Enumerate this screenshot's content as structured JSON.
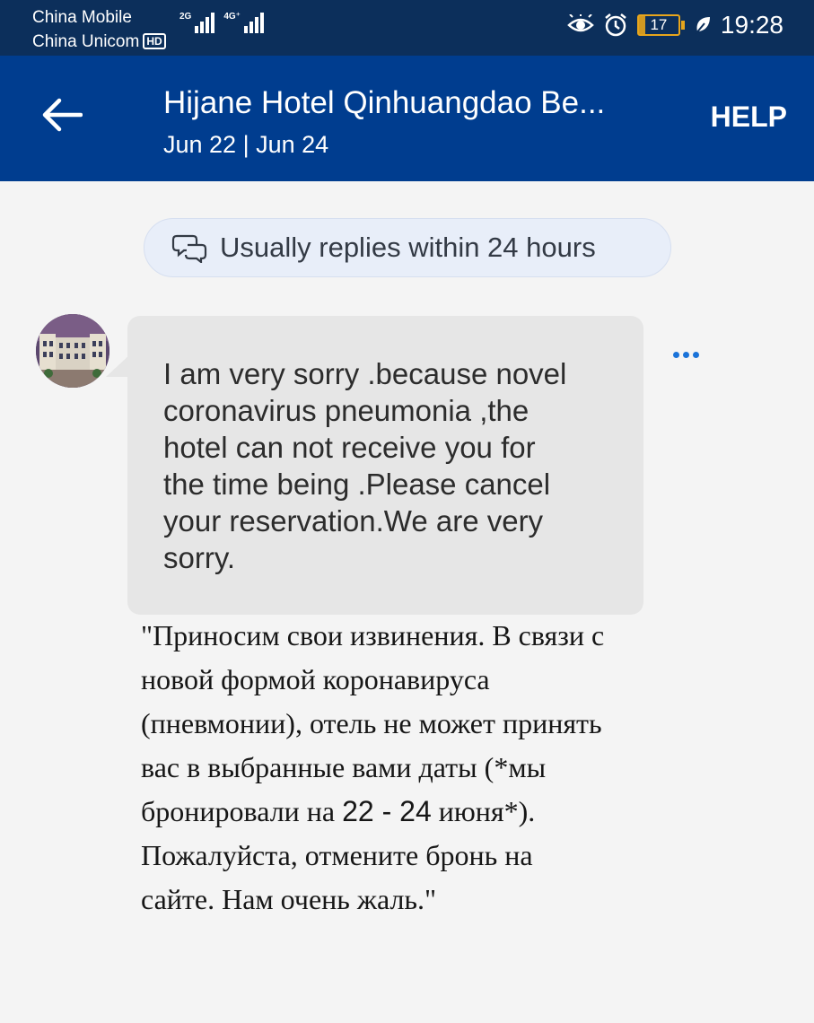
{
  "status_bar": {
    "carrier1": "China Mobile",
    "carrier2": "China Unicom",
    "hd_badge": "HD",
    "signal1_tag": "2G",
    "signal2_tag": "4G⁺",
    "battery": "17",
    "time": "19:28",
    "icons": [
      "eye-icon",
      "alarm-icon",
      "battery-icon",
      "leaf-icon"
    ]
  },
  "app_bar": {
    "title": "Hijane Hotel Qinhuangdao Be...",
    "dates": "Jun 22 | Jun 24",
    "help_label": "HELP",
    "background_color": "#003d8f"
  },
  "reply_pill": {
    "text": "Usually replies within 24 hours"
  },
  "message": {
    "lines": [
      "I am very sorry .because novel",
      "coronavirus pneumonia ,the",
      "hotel can not receive you for",
      "the time being .Please cancel",
      "your reservation.We are very",
      "sorry."
    ]
  },
  "translation": {
    "line1": "\"Приносим свои извинения. В связи с",
    "line2": "новой формой коронавируса",
    "line3": "(пневмонии), отель не может принять",
    "line4": "вас в выбранные вами даты (*мы",
    "line5_a": "бронировали на ",
    "line5_b": "22 - 24",
    "line5_c": " июня*).",
    "line6": "Пожалуйста, отмените бронь на",
    "line7": "сайте. Нам очень жаль.\""
  }
}
